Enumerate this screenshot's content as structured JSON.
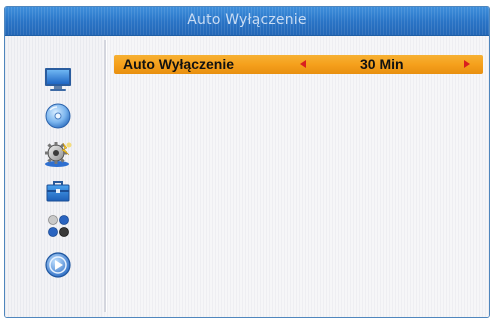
{
  "window": {
    "title": "Auto Wyłączenie"
  },
  "sidebar": {
    "items": [
      {
        "icon": "tv-icon"
      },
      {
        "icon": "disc-icon"
      },
      {
        "icon": "settings-gear-icon"
      },
      {
        "icon": "toolbox-icon"
      },
      {
        "icon": "games-icon"
      },
      {
        "icon": "media-player-icon"
      }
    ]
  },
  "setting": {
    "label": "Auto Wyłączenie",
    "value": "30 Min",
    "left_arrow": "left-arrow-icon",
    "right_arrow": "right-arrow-icon"
  },
  "colors": {
    "title_bar": "#2a75c7",
    "highlight": "#f5a01c",
    "arrow": "#d91f1f"
  }
}
